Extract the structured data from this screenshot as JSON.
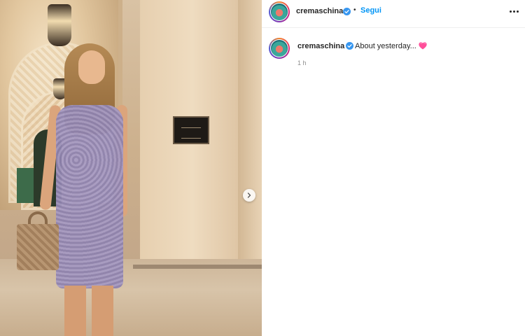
{
  "post": {
    "username": "cremaschina",
    "follow_label": "Segui",
    "separator": "•",
    "caption_text": "About yesterday...",
    "caption_emoji": "heart-emoji",
    "timestamp": "1 h"
  },
  "colors": {
    "link_blue": "#0095f6",
    "verified_blue": "#3897f0",
    "text_dark": "#262626",
    "text_muted": "#8e8e8e"
  },
  "icons": {
    "next": "chevron-right-icon",
    "more": "more-options-icon",
    "verified": "verified-badge-icon"
  }
}
